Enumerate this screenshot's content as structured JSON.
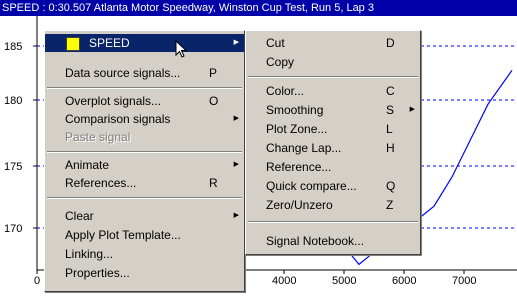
{
  "title": "SPEED : 0:30.507 Atlanta Motor Speedway, Winston Cup Test, Run 5, Lap 3",
  "colors": {
    "trace": "#0000ff",
    "menu_bg": "#d4d0c8",
    "highlight": "#0a246a",
    "swatch": "#ffff00"
  },
  "chart_data": {
    "type": "line",
    "y_ticks": [
      "185",
      "180",
      "175",
      "170"
    ],
    "x_ticks": [
      "0",
      "4000",
      "5000",
      "6000",
      "7000"
    ],
    "series": [
      {
        "x": [
          3900,
          4200,
          4700,
          5000,
          5150,
          5250,
          5400,
          5550,
          5800,
          6100,
          6500,
          6800,
          7100,
          7400,
          7800
        ],
        "y": [
          170.2,
          169.9,
          169.3,
          168.6,
          167.6,
          167.0,
          167.6,
          168.3,
          169.3,
          170.2,
          171.8,
          174.2,
          177.2,
          180.2,
          183.0
        ]
      }
    ]
  },
  "main_menu": {
    "header": "SPEED",
    "items": [
      {
        "label": "Data source signals...",
        "shortcut": "P"
      },
      {
        "label": "Overplot signals...",
        "shortcut": "O"
      },
      {
        "label": "Comparison signals",
        "shortcut": ""
      },
      {
        "label": "Paste signal",
        "shortcut": ""
      },
      {
        "label": "Animate",
        "shortcut": ""
      },
      {
        "label": "References...",
        "shortcut": "R"
      },
      {
        "label": "Clear",
        "shortcut": ""
      },
      {
        "label": "Apply Plot Template...",
        "shortcut": ""
      },
      {
        "label": "Linking...",
        "shortcut": ""
      },
      {
        "label": "Properties...",
        "shortcut": ""
      }
    ]
  },
  "sub_menu": {
    "items": [
      {
        "label": "Cut",
        "shortcut": "D"
      },
      {
        "label": "Copy",
        "shortcut": ""
      },
      {
        "label": "Color...",
        "shortcut": "C"
      },
      {
        "label": "Smoothing",
        "shortcut": "S"
      },
      {
        "label": "Plot Zone...",
        "shortcut": "L"
      },
      {
        "label": "Change Lap...",
        "shortcut": "H"
      },
      {
        "label": "Reference...",
        "shortcut": ""
      },
      {
        "label": "Quick compare...",
        "shortcut": "Q"
      },
      {
        "label": "Zero/Unzero",
        "shortcut": "Z"
      },
      {
        "label": "Signal Notebook...",
        "shortcut": ""
      }
    ]
  }
}
